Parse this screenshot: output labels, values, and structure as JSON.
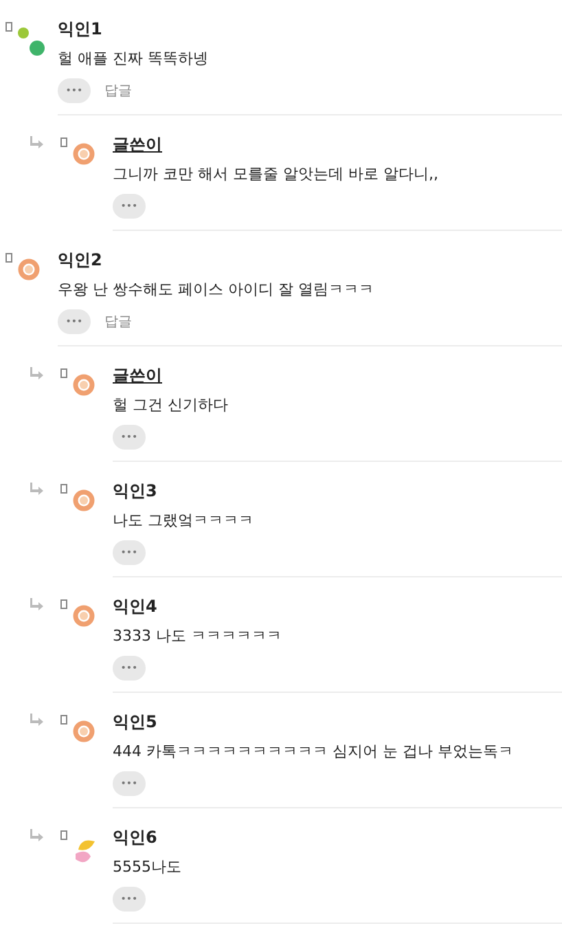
{
  "comments": [
    {
      "name": "익인1",
      "is_author": false,
      "text": "헐 애플 진짜 똑똑하넹",
      "avatar": {
        "kind": "dots"
      },
      "more": "•••",
      "reply_label": "답글",
      "children": [
        {
          "name": "글쓴이",
          "is_author": true,
          "text": "그니까 코만 해서 모를줄 알앗는데 바로 알다니,,",
          "avatar": {
            "kind": "ring"
          },
          "more": "•••"
        }
      ]
    },
    {
      "name": "익인2",
      "is_author": false,
      "text": "우왕 난 쌍수해도 페이스 아이디 잘 열림ㅋㅋㅋ",
      "avatar": {
        "kind": "ring"
      },
      "more": "•••",
      "reply_label": "답글",
      "children": [
        {
          "name": "글쓴이",
          "is_author": true,
          "text": "헐 그건 신기하다",
          "avatar": {
            "kind": "ring"
          },
          "more": "•••"
        },
        {
          "name": "익인3",
          "is_author": false,
          "text": "나도 그랬엌ㅋㅋㅋㅋ",
          "avatar": {
            "kind": "ring"
          },
          "more": "•••"
        },
        {
          "name": "익인4",
          "is_author": false,
          "text": "3333 나도 ㅋㅋㅋㅋㅋㅋ",
          "avatar": {
            "kind": "ring"
          },
          "more": "•••"
        },
        {
          "name": "익인5",
          "is_author": false,
          "text": "444 카톡ㅋㅋㅋㅋㅋㅋㅋㅋㅋㅋ 심지어 눈 겁나 부었는독ㅋ",
          "avatar": {
            "kind": "ring"
          },
          "more": "•••"
        },
        {
          "name": "익인6",
          "is_author": false,
          "text": "5555나도",
          "avatar": {
            "kind": "blob"
          },
          "more": "•••"
        }
      ]
    }
  ]
}
